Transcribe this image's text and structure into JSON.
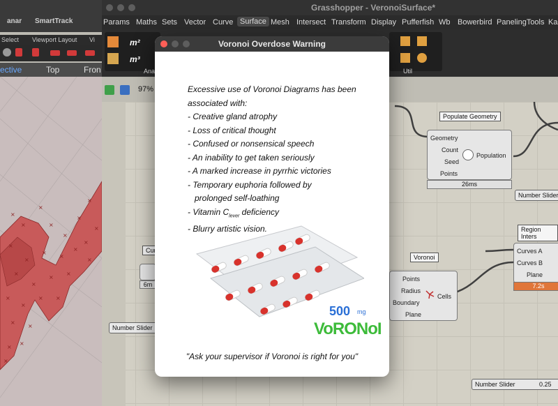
{
  "rhino": {
    "tabs": [
      "Select",
      "Viewport Layout",
      "Vi"
    ],
    "title_left": "anar",
    "title_mid": "SmartTrack",
    "viewport_tabs": [
      "ective",
      "Top",
      "Fron"
    ]
  },
  "grasshopper": {
    "title": "Grasshopper - VeronoiSurface*",
    "menu": [
      "Params",
      "Maths",
      "Sets",
      "Vector",
      "Curve",
      "Surface",
      "Mesh",
      "Intersect",
      "Transform",
      "Display",
      "Pufferfish",
      "Wb",
      "Bowerbird",
      "PanelingTools",
      "Ka"
    ],
    "selected_menu": "Surface",
    "ribbon_sections": [
      "Ana",
      "Util"
    ],
    "zoom": "97%",
    "components": {
      "populate": {
        "bubble": "Populate Geometry",
        "inputs": [
          "Geometry",
          "Count",
          "Seed",
          "Points"
        ],
        "output": "Population",
        "time": "26ms"
      },
      "voronoi": {
        "bubble": "Voronoi",
        "inputs": [
          "Points",
          "Radius",
          "Boundary",
          "Plane"
        ],
        "output": "Cells"
      },
      "region": {
        "bubble": "Region Inters",
        "inputs": [
          "Curves A",
          "Curves B",
          "Plane"
        ],
        "time": "7.2s"
      },
      "left_comp_label": "Cur",
      "left_comp_time": "6m"
    },
    "sliders": [
      {
        "label": "Number Slider"
      },
      {
        "label": "Number Slider"
      },
      {
        "label": "Number Slider",
        "value": "0.25"
      }
    ]
  },
  "dialog": {
    "title": "Voronoi Overdose Warning",
    "lines": [
      "Excessive use of Voronoi Diagrams has been",
      "associated with:",
      "- Creative gland atrophy",
      "- Loss of critical thought",
      "- Confused or nonsensical speech",
      "- An inability to get taken seriously",
      "- A marked increase in pyrrhic victories",
      "- Temporary euphoria followed by",
      "  prolonged self-loathing"
    ],
    "vitamin_prefix": "- Vitamin C",
    "vitamin_sub": "lever",
    "vitamin_suffix": " deficiency",
    "last_line": "- Blurry artistic vision.",
    "dose": "500",
    "dose_unit": "mg",
    "brand": "VoRONoI",
    "quote": "\"Ask your supervisor if Voronoi is right for you\""
  },
  "colors": {
    "pill_red": "#d8322c",
    "brand_green": "#3dbb3a",
    "brand_blue": "#2a6fd6",
    "region_bar": "#e0763a"
  }
}
